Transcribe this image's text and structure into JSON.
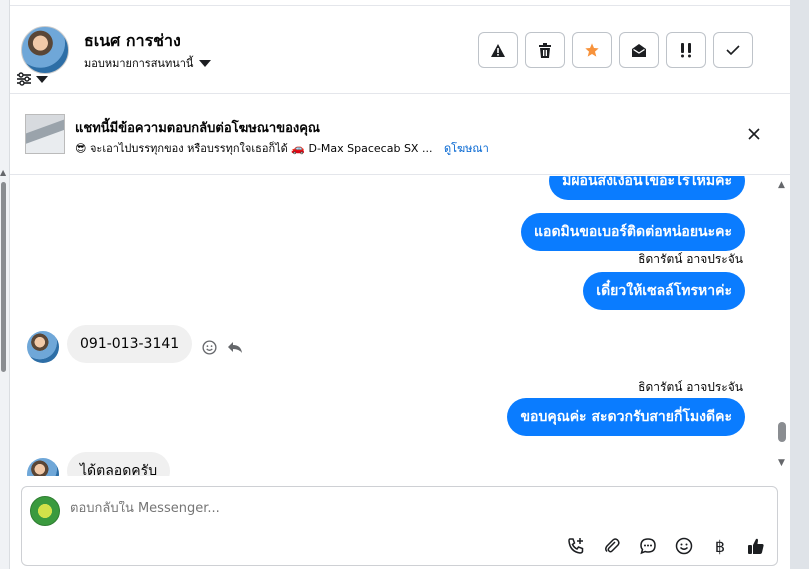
{
  "contact": {
    "name": "ธเนศ การช่าง",
    "assign_label": "มอบหมายการสนทนานี้"
  },
  "toolbar": {
    "buttons": [
      {
        "name": "spam-button",
        "icon": "warning-icon"
      },
      {
        "name": "delete-button",
        "icon": "trash-icon"
      },
      {
        "name": "star-button",
        "icon": "star-icon",
        "color": "#f7923b"
      },
      {
        "name": "mark-unread-button",
        "icon": "envelope-open-icon"
      },
      {
        "name": "priority-button",
        "icon": "double-exclamation-icon"
      },
      {
        "name": "done-button",
        "icon": "check-icon"
      }
    ]
  },
  "ad_banner": {
    "title": "แชทนี้มีข้อความตอบกลับต่อโฆษณาของคุณ",
    "emoji": "😎",
    "text": "จะเอาไปบรรทุกของ หรือบรรทุกใจเธอก็ได้ 🚗 D-Max Spacecab SX ...",
    "link": "ดูโฆษณา"
  },
  "messages": {
    "out_cut": "มีผ่อนส่งเงื่อนไขอะไรไหมคะ",
    "out1": "แอดมินขอเบอร์ติดต่อหน่อยนะคะ",
    "sender1": "ธิดารัตน์ อาจประจัน",
    "out2": "เดี๋ยวให้เซลล์โทรหาค่ะ",
    "in1": "091-013-3141",
    "sender2": "ธิดารัตน์ อาจประจัน",
    "out3": "ขอบคุณค่ะ สะดวกรับสายกี่โมงดีคะ",
    "in_cut": "ได้ตลอดครับ"
  },
  "composer": {
    "placeholder": "ตอบกลับใน Messenger...",
    "baht_symbol": "฿"
  },
  "colors": {
    "outgoing_bubble": "#0a7cff",
    "incoming_bubble": "#f0f0f0",
    "link": "#0064d1"
  }
}
